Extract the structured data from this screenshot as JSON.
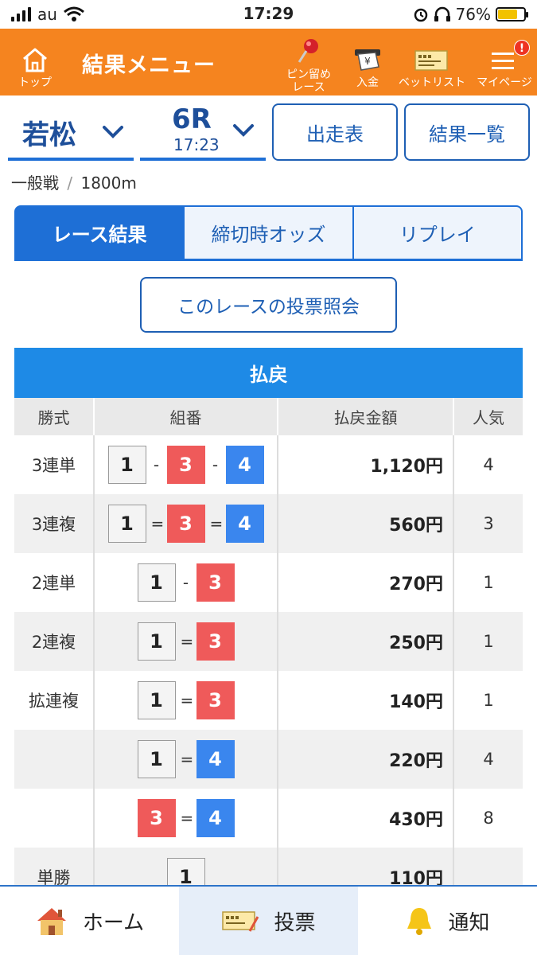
{
  "status_bar": {
    "carrier": "au",
    "time": "17:29",
    "battery": "76%"
  },
  "header": {
    "top_label": "トップ",
    "title": "結果メニュー",
    "pin_label_1": "ピン留め",
    "pin_label_2": "レース",
    "deposit_label": "入金",
    "betlist_label": "ベットリスト",
    "mypage_label": "マイページ",
    "notification_count": "!"
  },
  "selector": {
    "venue": "若松",
    "race": "6R",
    "race_time": "17:23",
    "entries_button": "出走表",
    "results_list_button": "結果一覧"
  },
  "race_info": {
    "grade": "一般戦",
    "divider": "/",
    "distance": "1800m"
  },
  "tabs": [
    {
      "label": "レース結果",
      "active": true
    },
    {
      "label": "締切時オッズ",
      "active": false
    },
    {
      "label": "リプレイ",
      "active": false
    }
  ],
  "vote_inquiry_button": "このレースの投票照会",
  "payout": {
    "title": "払戻",
    "headers": [
      "勝式",
      "組番",
      "払戻金額",
      "人気"
    ],
    "rows": [
      {
        "type": "3連単",
        "combo": [
          "1",
          "-",
          "3",
          "-",
          "4"
        ],
        "amount": "1,120円",
        "popularity": "4"
      },
      {
        "type": "3連複",
        "combo": [
          "1",
          "=",
          "3",
          "=",
          "4"
        ],
        "amount": "560円",
        "popularity": "3"
      },
      {
        "type": "2連単",
        "combo": [
          "1",
          "-",
          "3"
        ],
        "amount": "270円",
        "popularity": "1"
      },
      {
        "type": "2連複",
        "combo": [
          "1",
          "=",
          "3"
        ],
        "amount": "250円",
        "popularity": "1"
      },
      {
        "type": "拡連複",
        "combo": [
          "1",
          "=",
          "3"
        ],
        "amount": "140円",
        "popularity": "1"
      },
      {
        "type": "",
        "combo": [
          "1",
          "=",
          "4"
        ],
        "amount": "220円",
        "popularity": "4"
      },
      {
        "type": "",
        "combo": [
          "3",
          "=",
          "4"
        ],
        "amount": "430円",
        "popularity": "8"
      },
      {
        "type": "単勝",
        "combo": [
          "1"
        ],
        "amount": "110円",
        "popularity": ""
      }
    ]
  },
  "bottom_nav": [
    {
      "label": "ホーム",
      "icon": "home-icon"
    },
    {
      "label": "投票",
      "icon": "ticket-icon"
    },
    {
      "label": "通知",
      "icon": "bell-icon"
    }
  ],
  "colors": {
    "orange": "#f5841f",
    "blue": "#1e6fd6",
    "boat3": "#ef5a5a",
    "boat4": "#3a86ee"
  }
}
